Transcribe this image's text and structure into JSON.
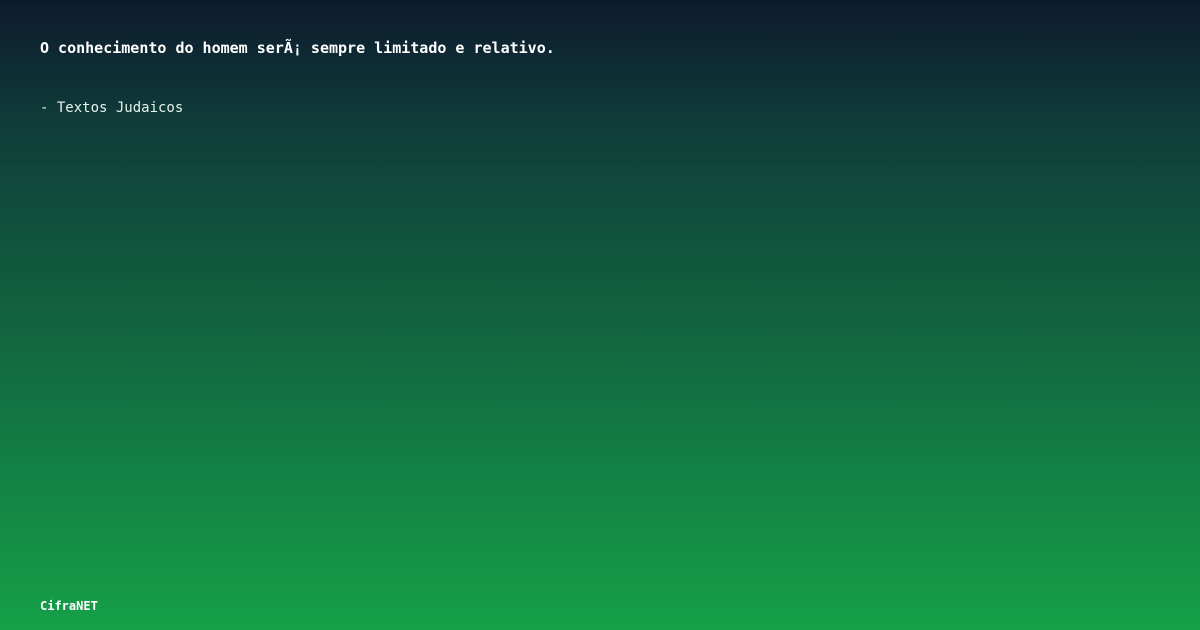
{
  "quote": {
    "text": "O conhecimento do homem serÃ¡ sempre limitado e relativo.",
    "author": "- Textos Judaicos"
  },
  "brand": {
    "name": "CifraNET"
  },
  "colors": {
    "background_top": "#0d1a2e",
    "background_bottom": "#15a048",
    "text": "#ffffff"
  }
}
